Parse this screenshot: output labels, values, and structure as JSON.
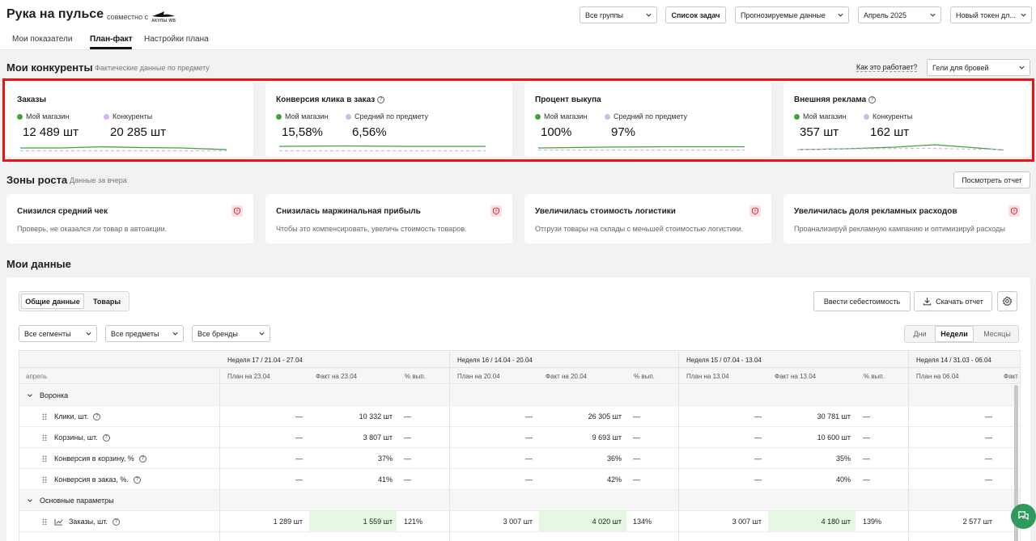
{
  "app": {
    "title": "Рука на пульсе",
    "partner_prefix": "совместно с",
    "partner_logo_text": "АКУЛЫ WB"
  },
  "header": {
    "selects": {
      "groups": "Все группы",
      "data_mode": "Прогнозируемые данные",
      "month": "Апрель 2025",
      "token": "Новый токен дл..."
    },
    "task_button": "Список задач"
  },
  "nav": {
    "tabs": [
      "Мои показатели",
      "План-факт",
      "Настройки плана"
    ],
    "active": "План-факт"
  },
  "competitors": {
    "title": "Мои конкуренты",
    "subtitle": "Фактические данные по предмету",
    "how_link": "Как это работает?",
    "category_select": "Гели для бровей",
    "cards": [
      {
        "title": "Заказы",
        "info": false,
        "mine_label": "Мой магазин",
        "other_label": "Конкуренты",
        "mine_value": "12 489 шт",
        "other_value": "20 285 шт"
      },
      {
        "title": "Конверсия клика в заказ",
        "info": true,
        "mine_label": "Мой магазин",
        "other_label": "Средний по предмету",
        "mine_value": "15,58%",
        "other_value": "6,56%"
      },
      {
        "title": "Процент выкупа",
        "info": false,
        "mine_label": "Мой магазин",
        "other_label": "Средний по предмету",
        "mine_value": "100%",
        "other_value": "97%"
      },
      {
        "title": "Внешняя реклама",
        "info": true,
        "mine_label": "Мой магазин",
        "other_label": "Конкуренты",
        "mine_value": "357 шт",
        "other_value": "162 шт"
      }
    ]
  },
  "growth": {
    "title": "Зоны роста",
    "subtitle": "Данные за вчера",
    "report_button": "Посмотреть отчет",
    "cards": [
      {
        "title": "Снизился средний чек",
        "desc": "Проверь, не оказался ли товар в автоакции."
      },
      {
        "title": "Снизилась маржинальная прибыль",
        "desc": "Чтобы это компенсировать, увеличь стоимость товаров."
      },
      {
        "title": "Увеличилась стоимость логистики",
        "desc": "Отгрузи товары на склады с меньшей стоимостью логистики."
      },
      {
        "title": "Увеличилась доля рекламных расходов",
        "desc": "Проанализируй рекламную кампанию и оптимизируй расходы"
      }
    ]
  },
  "mydata": {
    "title": "Мои данные",
    "tabs": [
      "Общие данные",
      "Товары"
    ],
    "cost_button": "Ввести себестоимость",
    "download_button": "Скачать отчет",
    "filters": [
      "Все сегменты",
      "Все предметы",
      "Все бренды"
    ],
    "periods": [
      "Дни",
      "Недели",
      "Месяцы"
    ],
    "active_period": "Недели"
  },
  "table": {
    "month_label": "апрель",
    "weeks": [
      {
        "label": "Неделя 17 / 21.04 - 27.04",
        "plan": "План на 23.04",
        "fact": "Факт на 23.04",
        "pct": "% вып."
      },
      {
        "label": "Неделя 16 / 14.04 - 20.04",
        "plan": "План на 20.04",
        "fact": "Факт на 20.04",
        "pct": "% вып."
      },
      {
        "label": "Неделя 15 / 07.04 - 13.04",
        "plan": "План на 13.04",
        "fact": "Факт на 13.04",
        "pct": "% вып."
      },
      {
        "label": "Неделя 14 / 31.03 - 06.04",
        "plan": "План на 06.04",
        "fact": "Факт",
        "pct": ""
      }
    ],
    "groups": {
      "funnel": "Воронка",
      "main": "Основные параметры"
    },
    "funnel_rows": [
      {
        "label": "Клики, шт.",
        "cells": [
          "—",
          "10 332 шт",
          "—",
          "—",
          "26 305 шт",
          "—",
          "—",
          "30 781 шт",
          "—",
          "—"
        ]
      },
      {
        "label": "Корзины, шт.",
        "cells": [
          "—",
          "3 807 шт",
          "—",
          "—",
          "9 693 шт",
          "—",
          "—",
          "10 600 шт",
          "—",
          "—"
        ]
      },
      {
        "label": "Конверсия в корзину, %",
        "cells": [
          "—",
          "37%",
          "—",
          "—",
          "36%",
          "—",
          "—",
          "35%",
          "—",
          "—"
        ]
      },
      {
        "label": "Конверсия в заказ, %.",
        "cells": [
          "—",
          "41%",
          "—",
          "—",
          "42%",
          "—",
          "—",
          "40%",
          "—",
          "—"
        ]
      }
    ],
    "main_rows": [
      {
        "label": "Заказы, шт.",
        "cells": [
          "1 289 шт",
          "1 559 шт",
          "121%",
          "3 007 шт",
          "4 020 шт",
          "134%",
          "3 007 шт",
          "4 180 шт",
          "139%",
          "2 577 шт"
        ]
      }
    ]
  },
  "colors": {
    "mine": "#3fa535",
    "other": "#d8b4ec",
    "highlight": "#e11111",
    "fact_bg": "#e6f7e3"
  }
}
